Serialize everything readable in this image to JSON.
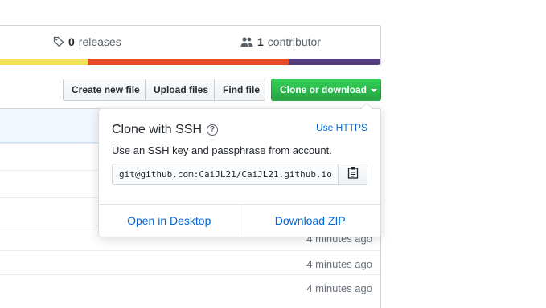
{
  "summary": {
    "releases_count": "0",
    "releases_label": "releases",
    "contributors_count": "1",
    "contributors_label": "contributor"
  },
  "language_bar": [
    {
      "color": "#f1e05a",
      "fraction": 0.23
    },
    {
      "color": "#e34c26",
      "fraction": 0.53
    },
    {
      "color": "#563d7c",
      "fraction": 0.24
    }
  ],
  "toolbar": {
    "create_new_file": "Create new file",
    "upload_files": "Upload files",
    "find_file": "Find file",
    "clone_or_download": "Clone or download"
  },
  "clone_dropdown": {
    "title": "Clone with SSH",
    "help_glyph": "?",
    "use_https": "Use HTTPS",
    "description": "Use an SSH key and passphrase from account.",
    "url": "git@github.com:CaiJL21/CaiJL21.github.io",
    "open_in_desktop": "Open in Desktop",
    "download_zip": "Download ZIP"
  },
  "file_rows": [
    {
      "age": ""
    },
    {
      "age": ""
    },
    {
      "age": ""
    },
    {
      "age": "4 minutes ago"
    },
    {
      "age": "4 minutes ago"
    },
    {
      "age": "4 minutes ago"
    }
  ],
  "colors": {
    "accent_green": "#28a745",
    "link_blue": "#0366d6"
  },
  "icons": {
    "releases": "tag-icon",
    "contributors": "people-icon",
    "copy": "clipboard-icon"
  }
}
